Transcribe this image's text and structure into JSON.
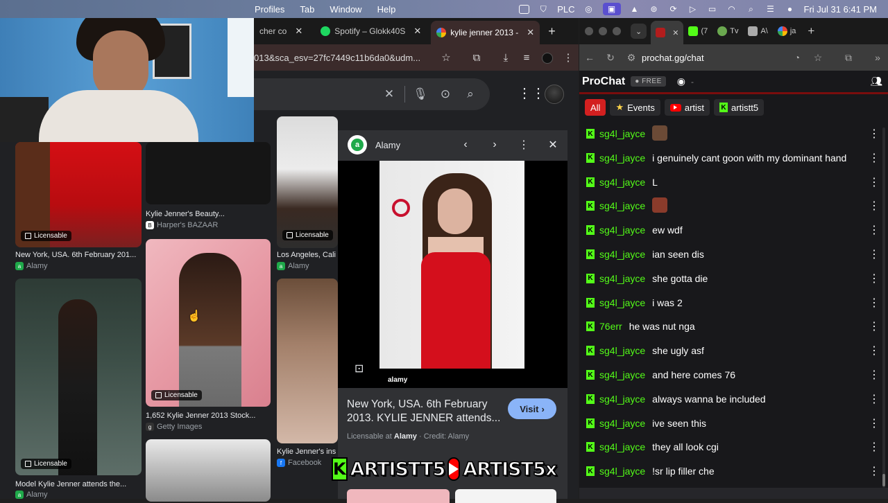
{
  "menubar": {
    "menus": [
      "Profiles",
      "Tab",
      "Window",
      "Help"
    ],
    "plc_label": "PLC",
    "datetime": "Fri Jul 31  6:41 PM"
  },
  "left_browser": {
    "tabs": [
      {
        "label": "cher co",
        "active": false
      },
      {
        "label": "Spotify – Glokk40S",
        "active": false
      },
      {
        "label": "kylie jenner 2013 -",
        "active": true
      }
    ],
    "url": "013&sca_esv=27fc7449c11b6da0&udm..."
  },
  "results": [
    {
      "caption": "New York, USA. 6th February 201...",
      "source": "Alamy",
      "badge": "Licensable"
    },
    {
      "caption": "Kylie Jenner's Beauty...",
      "source": "Harper's BAZAAR",
      "badge": ""
    },
    {
      "caption": "Los Angeles, Cali",
      "source": "Alamy",
      "badge": "Licensable"
    },
    {
      "caption": "1,652 Kylie Jenner 2013 Stock...",
      "source": "Getty Images",
      "badge": "Licensable"
    },
    {
      "caption": "Model Kylie Jenner attends the...",
      "source": "Alamy",
      "badge": "Licensable"
    },
    {
      "caption": "Kylie Jenner's ins",
      "source": "Facebook",
      "badge": ""
    }
  ],
  "preview": {
    "source": "Alamy",
    "title": "New York, USA. 6th February 2013. KYLIE JENNER attends...",
    "visit_label": "Visit",
    "license_prefix": "Licensable at",
    "license_source": "Alamy",
    "license_credit": " · Credit: Alamy",
    "watermark": "alamy"
  },
  "overlay": {
    "kick_name": "ARTISTT5",
    "youtube_name": "ARTIST5x"
  },
  "right_browser": {
    "tabs": [
      "(7",
      "Tv",
      "A\\",
      "ja"
    ],
    "url": "prochat.gg/chat"
  },
  "prochat": {
    "title": "ProChat",
    "plan": "FREE",
    "filters": [
      {
        "label": "All",
        "active": true
      },
      {
        "label": "Events",
        "active": false
      },
      {
        "label": "artist",
        "active": false
      },
      {
        "label": "artistt5",
        "active": false
      }
    ],
    "messages": [
      {
        "user": "sg4l_jayce",
        "text": "",
        "emote": "face-emote"
      },
      {
        "user": "sg4l_jayce",
        "text": "i genuinely cant goon with my dominant hand"
      },
      {
        "user": "sg4l_jayce",
        "text": "L"
      },
      {
        "user": "sg4l_jayce",
        "text": "",
        "emote": "face-emote"
      },
      {
        "user": "sg4l_jayce",
        "text": "ew wdf"
      },
      {
        "user": "sg4l_jayce",
        "text": "ian seen dis"
      },
      {
        "user": "sg4l_jayce",
        "text": "she gotta die"
      },
      {
        "user": "sg4l_jayce",
        "text": "i was 2"
      },
      {
        "user": "76err",
        "text": "he was nut nga"
      },
      {
        "user": "sg4l_jayce",
        "text": "she ugly asf"
      },
      {
        "user": "sg4l_jayce",
        "text": "and here comes 76"
      },
      {
        "user": "sg4l_jayce",
        "text": "always wanna be included"
      },
      {
        "user": "sg4l_jayce",
        "text": "ive seen this"
      },
      {
        "user": "sg4l_jayce",
        "text": "they all look cgi"
      },
      {
        "user": "sg4l_jayce",
        "text": "!sr lip filler che"
      }
    ]
  },
  "colors": {
    "kick_green": "#53fc18",
    "youtube_red": "#ff0000",
    "prochat_red": "#d32020",
    "google_blue": "#8ab4f8"
  }
}
